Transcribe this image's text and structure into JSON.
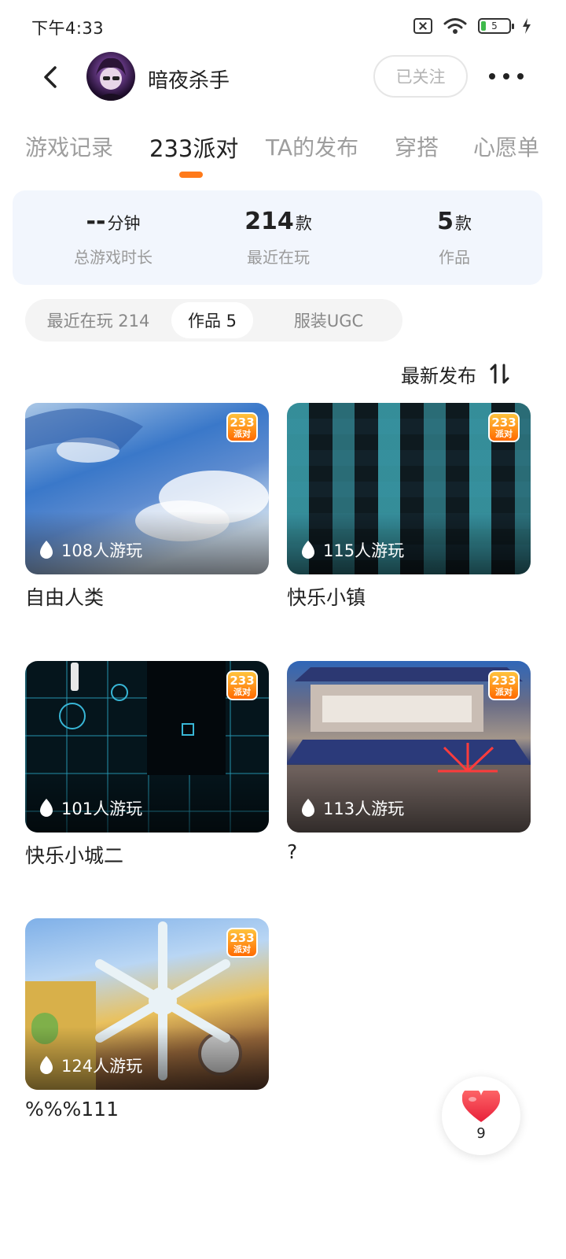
{
  "status_bar": {
    "time": "下午4:33",
    "battery": "5"
  },
  "header": {
    "username": "暗夜杀手",
    "follow_label": "已关注"
  },
  "tabs": [
    {
      "label": "游戏记录"
    },
    {
      "label": "233派对"
    },
    {
      "label": "TA的发布"
    },
    {
      "label": "穿搭"
    },
    {
      "label": "心愿单"
    }
  ],
  "active_tab": "233派对",
  "stats": [
    {
      "value": "--",
      "unit": "分钟",
      "label": "总游戏时长"
    },
    {
      "value": "214",
      "unit": "款",
      "label": "最近在玩"
    },
    {
      "value": "5",
      "unit": "款",
      "label": "作品"
    }
  ],
  "segments": [
    {
      "label": "最近在玩 214"
    },
    {
      "label": "作品 5"
    },
    {
      "label": "服装UGC"
    }
  ],
  "active_segment": "作品 5",
  "sort": {
    "label": "最新发布"
  },
  "badge": {
    "num": "233",
    "text": "派对"
  },
  "works": [
    {
      "plays": "108人游玩",
      "title": "自由人类"
    },
    {
      "plays": "115人游玩",
      "title": "快乐小镇"
    },
    {
      "plays": "101人游玩",
      "title": "快乐小城二"
    },
    {
      "plays": "113人游玩",
      "title": "?"
    },
    {
      "plays": "124人游玩",
      "title": "%%%111"
    }
  ],
  "like": {
    "count": "9"
  },
  "colors": {
    "accent": "#ff7a1a",
    "stats_bg": "#f2f6fd",
    "heart": "#f23a4a"
  }
}
